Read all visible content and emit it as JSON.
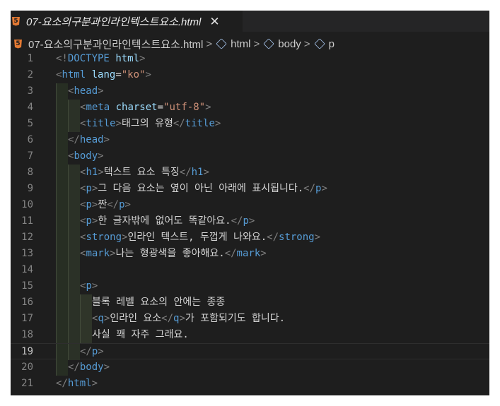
{
  "tab": {
    "title": "07-요소의구분과인라인텍스트요소.html",
    "close_glyph": "✕",
    "icon": "html5-icon",
    "icon_glyph": "5",
    "icon_color": "#e37933"
  },
  "breadcrumb": {
    "file": "07-요소의구분과인라인텍스트요소.html",
    "separator": ">",
    "items": [
      "html",
      "body",
      "p"
    ],
    "item_icon": "element-cube-icon"
  },
  "editor": {
    "active_line": "19",
    "colors": {
      "background": "#1e1e1e",
      "tag": "#569cd6",
      "attribute": "#9cdcfe",
      "string": "#ce9178",
      "text": "#d4d4d4",
      "bracket": "#808080"
    },
    "lines": [
      {
        "n": "1",
        "indent": 0,
        "tokens": [
          [
            "br",
            "<!"
          ],
          [
            "doc",
            "DOCTYPE"
          ],
          [
            "txt",
            " "
          ],
          [
            "attr",
            "html"
          ],
          [
            "br",
            ">"
          ]
        ]
      },
      {
        "n": "2",
        "indent": 0,
        "tokens": [
          [
            "br",
            "<"
          ],
          [
            "tag",
            "html"
          ],
          [
            "txt",
            " "
          ],
          [
            "attr",
            "lang"
          ],
          [
            "txt",
            "="
          ],
          [
            "str",
            "\"ko\""
          ],
          [
            "br",
            ">"
          ]
        ]
      },
      {
        "n": "3",
        "indent": 1,
        "tokens": [
          [
            "br",
            "<"
          ],
          [
            "tag",
            "head"
          ],
          [
            "br",
            ">"
          ]
        ]
      },
      {
        "n": "4",
        "indent": 2,
        "tokens": [
          [
            "br",
            "<"
          ],
          [
            "tag",
            "meta"
          ],
          [
            "txt",
            " "
          ],
          [
            "attr",
            "charset"
          ],
          [
            "txt",
            "="
          ],
          [
            "str",
            "\"utf-8\""
          ],
          [
            "br",
            ">"
          ]
        ]
      },
      {
        "n": "5",
        "indent": 2,
        "tokens": [
          [
            "br",
            "<"
          ],
          [
            "tag",
            "title"
          ],
          [
            "br",
            ">"
          ],
          [
            "txt",
            "태그의 유형"
          ],
          [
            "br",
            "</"
          ],
          [
            "tag",
            "title"
          ],
          [
            "br",
            ">"
          ]
        ]
      },
      {
        "n": "6",
        "indent": 1,
        "tokens": [
          [
            "br",
            "</"
          ],
          [
            "tag",
            "head"
          ],
          [
            "br",
            ">"
          ]
        ]
      },
      {
        "n": "7",
        "indent": 1,
        "tokens": [
          [
            "br",
            "<"
          ],
          [
            "tag",
            "body"
          ],
          [
            "br",
            ">"
          ]
        ]
      },
      {
        "n": "8",
        "indent": 2,
        "tokens": [
          [
            "br",
            "<"
          ],
          [
            "tag",
            "h1"
          ],
          [
            "br",
            ">"
          ],
          [
            "txt",
            "텍스트 요소 특징"
          ],
          [
            "br",
            "</"
          ],
          [
            "tag",
            "h1"
          ],
          [
            "br",
            ">"
          ]
        ]
      },
      {
        "n": "9",
        "indent": 2,
        "tokens": [
          [
            "br",
            "<"
          ],
          [
            "tag",
            "p"
          ],
          [
            "br",
            ">"
          ],
          [
            "txt",
            "그 다음 요소는 옆이 아닌 아래에 표시됩니다."
          ],
          [
            "br",
            "</"
          ],
          [
            "tag",
            "p"
          ],
          [
            "br",
            ">"
          ]
        ]
      },
      {
        "n": "10",
        "indent": 2,
        "tokens": [
          [
            "br",
            "<"
          ],
          [
            "tag",
            "p"
          ],
          [
            "br",
            ">"
          ],
          [
            "txt",
            "짠"
          ],
          [
            "br",
            "</"
          ],
          [
            "tag",
            "p"
          ],
          [
            "br",
            ">"
          ]
        ]
      },
      {
        "n": "11",
        "indent": 2,
        "tokens": [
          [
            "br",
            "<"
          ],
          [
            "tag",
            "p"
          ],
          [
            "br",
            ">"
          ],
          [
            "txt",
            "한 글자밖에 없어도 똑같아요."
          ],
          [
            "br",
            "</"
          ],
          [
            "tag",
            "p"
          ],
          [
            "br",
            ">"
          ]
        ]
      },
      {
        "n": "12",
        "indent": 2,
        "tokens": [
          [
            "br",
            "<"
          ],
          [
            "tag",
            "strong"
          ],
          [
            "br",
            ">"
          ],
          [
            "txt",
            "인라인 텍스트, 두껍게 나와요."
          ],
          [
            "br",
            "</"
          ],
          [
            "tag",
            "strong"
          ],
          [
            "br",
            ">"
          ]
        ]
      },
      {
        "n": "13",
        "indent": 2,
        "tokens": [
          [
            "br",
            "<"
          ],
          [
            "tag",
            "mark"
          ],
          [
            "br",
            ">"
          ],
          [
            "txt",
            "나는 형광색을 좋아해요."
          ],
          [
            "br",
            "</"
          ],
          [
            "tag",
            "mark"
          ],
          [
            "br",
            ">"
          ]
        ]
      },
      {
        "n": "14",
        "indent": 2,
        "tokens": []
      },
      {
        "n": "15",
        "indent": 2,
        "tokens": [
          [
            "br",
            "<"
          ],
          [
            "tag",
            "p"
          ],
          [
            "br",
            ">"
          ]
        ]
      },
      {
        "n": "16",
        "indent": 3,
        "tokens": [
          [
            "txt",
            "블록 레벨 요소의 안에는 종종"
          ]
        ]
      },
      {
        "n": "17",
        "indent": 3,
        "tokens": [
          [
            "br",
            "<"
          ],
          [
            "tag",
            "q"
          ],
          [
            "br",
            ">"
          ],
          [
            "txt",
            "인라인 요소"
          ],
          [
            "br",
            "</"
          ],
          [
            "tag",
            "q"
          ],
          [
            "br",
            ">"
          ],
          [
            "txt",
            "가 포함되기도 합니다."
          ]
        ]
      },
      {
        "n": "18",
        "indent": 3,
        "tokens": [
          [
            "txt",
            "사실 꽤 자주 그래요."
          ]
        ]
      },
      {
        "n": "19",
        "indent": 2,
        "tokens": [
          [
            "br",
            "</"
          ],
          [
            "tag",
            "p"
          ],
          [
            "br",
            ">"
          ]
        ]
      },
      {
        "n": "20",
        "indent": 1,
        "tokens": [
          [
            "br",
            "</"
          ],
          [
            "tag",
            "body"
          ],
          [
            "br",
            ">"
          ]
        ]
      },
      {
        "n": "21",
        "indent": 0,
        "tokens": [
          [
            "br",
            "</"
          ],
          [
            "tag",
            "html"
          ],
          [
            "br",
            ">"
          ]
        ]
      }
    ]
  }
}
